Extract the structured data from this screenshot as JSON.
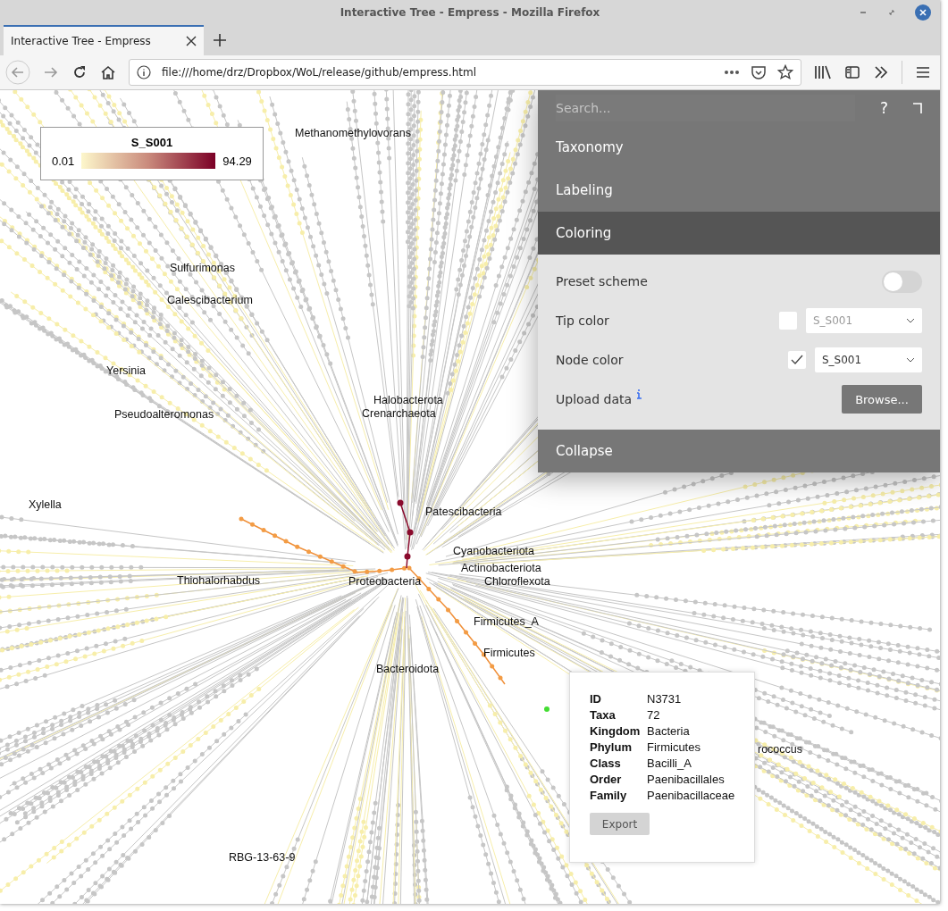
{
  "window": {
    "title": "Interactive Tree - Empress - Mozilla Firefox"
  },
  "tabs": [
    {
      "label": "Interactive Tree - Empress",
      "selected": true
    }
  ],
  "address_bar": {
    "url": "file:///home/drz/Dropbox/WoL/release/github/empress.html"
  },
  "legend": {
    "title": "S_S001",
    "min": "0.01",
    "max": "94.29"
  },
  "tree_labels": [
    {
      "text": "Methanomethylovorans"
    },
    {
      "text": "Sulfurimonas"
    },
    {
      "text": "Calescibacterium"
    },
    {
      "text": "Yersinia"
    },
    {
      "text": "Pseudoalteromonas"
    },
    {
      "text": "Halobacterota"
    },
    {
      "text": "Crenarchaeota"
    },
    {
      "text": "Xylella"
    },
    {
      "text": "Patescibacteria"
    },
    {
      "text": "Cyanobacteriota"
    },
    {
      "text": "Actinobacteriota"
    },
    {
      "text": "Thiohalorhabdus"
    },
    {
      "text": "Proteobacteria"
    },
    {
      "text": "Chloroflexota"
    },
    {
      "text": "Firmicutes_A"
    },
    {
      "text": "Firmicutes"
    },
    {
      "text": "Bacteroidota"
    },
    {
      "text": "rococcus"
    },
    {
      "text": "RBG-13-63-9"
    }
  ],
  "side_panel": {
    "search": {
      "placeholder": "Search..."
    },
    "help": "?",
    "sections": [
      {
        "title": "Taxonomy",
        "expanded": false
      },
      {
        "title": "Labeling",
        "expanded": false
      },
      {
        "title": "Coloring",
        "expanded": true
      },
      {
        "title": "Collapse",
        "expanded": false
      }
    ],
    "coloring_rows": [
      {
        "kind": "toggle",
        "label": "Preset scheme",
        "on": false
      },
      {
        "kind": "select",
        "label": "Tip color",
        "checked": false,
        "value": "S_S001"
      },
      {
        "kind": "select",
        "label": "Node color",
        "checked": true,
        "value": "S_S001"
      },
      {
        "kind": "upload",
        "label": "Upload data",
        "button": "Browse..."
      }
    ]
  },
  "node_popup": {
    "rows": [
      {
        "key": "ID",
        "value": "N3731"
      },
      {
        "key": "Taxa",
        "value": "72"
      },
      {
        "key": "Kingdom",
        "value": "Bacteria"
      },
      {
        "key": "Phylum",
        "value": "Firmicutes"
      },
      {
        "key": "Class",
        "value": "Bacilli_A"
      },
      {
        "key": "Order",
        "value": "Paenibacillales"
      },
      {
        "key": "Family",
        "value": "Paenibacillaceae"
      }
    ],
    "button": "Export"
  }
}
